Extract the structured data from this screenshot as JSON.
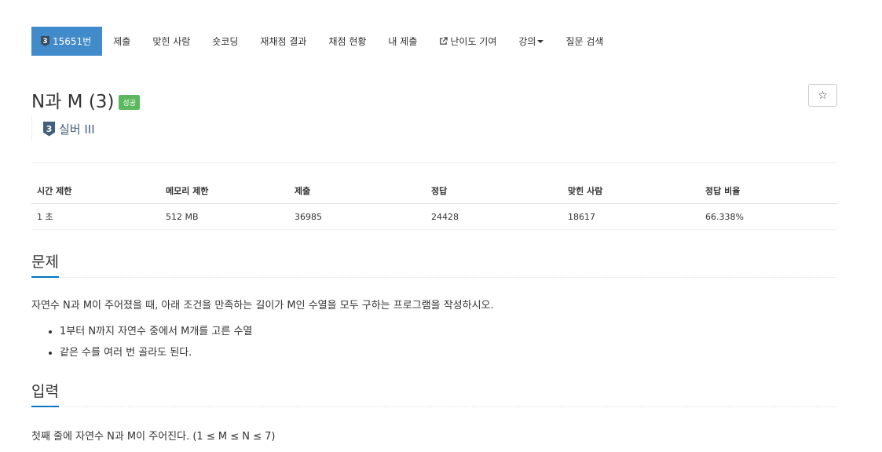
{
  "nav": {
    "problem_tier": "3",
    "problem_number": "15651번",
    "items": [
      "제출",
      "맞힌 사람",
      "숏코딩",
      "재채점 결과",
      "채점 현황",
      "내 제출",
      "난이도 기여",
      "강의",
      "질문 검색"
    ],
    "external_link_icon": "external-link-icon",
    "dropdown_icon": "caret-down-icon"
  },
  "problem": {
    "title": "N과 M (3)",
    "result_badge": "성공",
    "star_icon": "☆",
    "tier_number": "3",
    "tier_label": "실버 III",
    "tier_color": "#435f7a"
  },
  "info_table": {
    "headers": [
      "시간 제한",
      "메모리 제한",
      "제출",
      "정답",
      "맞힌 사람",
      "정답 비율"
    ],
    "row": [
      "1 초",
      "512 MB",
      "36985",
      "24428",
      "18617",
      "66.338%"
    ]
  },
  "sections": {
    "problem_title": "문제",
    "problem_text": "자연수 N과 M이 주어졌을 때, 아래 조건을 만족하는 길이가 M인 수열을 모두 구하는 프로그램을 작성하시오.",
    "conditions": [
      "1부터 N까지 자연수 중에서 M개를 고른 수열",
      "같은 수를 여러 번 골라도 된다."
    ],
    "input_title": "입력",
    "input_text": "첫째 줄에 자연수 N과 M이 주어진다. (1 ≤ M ≤ N ≤ 7)"
  },
  "colors": {
    "nav_active": "#428bca",
    "success_badge": "#5cb85c",
    "section_underline": "#0076c0"
  }
}
